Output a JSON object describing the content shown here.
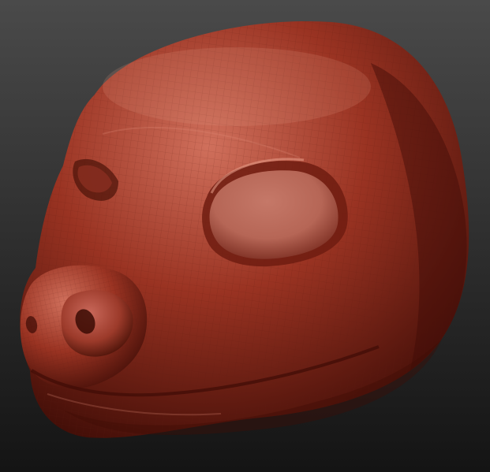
{
  "scene": {
    "subject_icon": "sculpted-animal-head-icon",
    "background_top_color": "#4a4a4a",
    "background_bottom_color": "#141414",
    "material_base_color": "#9a3322",
    "material_highlight_color": "#d0705c",
    "material_shadow_color": "#3e0c06",
    "eye_socket_color": "#b66656",
    "wireframe_color": "#5a1a10"
  }
}
